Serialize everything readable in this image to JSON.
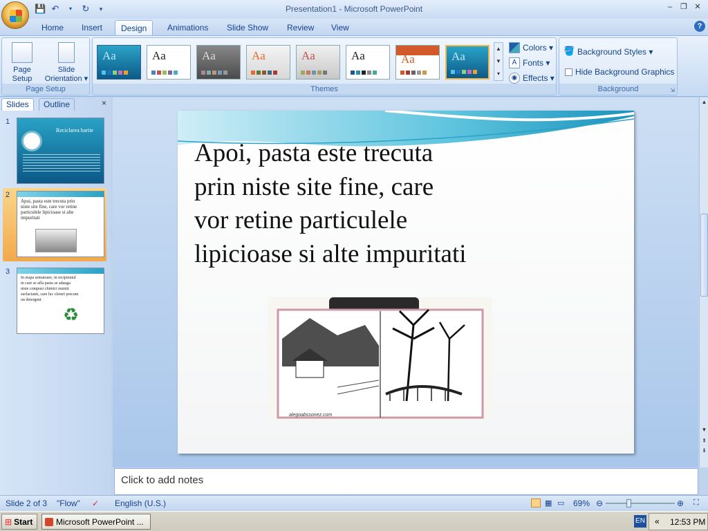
{
  "window": {
    "title": "Presentation1 - Microsoft PowerPoint"
  },
  "qat": {
    "save_icon": "save-icon",
    "undo_icon": "undo-icon",
    "redo_icon": "redo-icon",
    "customize_icon": "customize-icon"
  },
  "tabs": [
    {
      "label": "Home"
    },
    {
      "label": "Insert"
    },
    {
      "label": "Design"
    },
    {
      "label": "Animations"
    },
    {
      "label": "Slide Show"
    },
    {
      "label": "Review"
    },
    {
      "label": "View"
    }
  ],
  "ribbon": {
    "page_setup": {
      "group_label": "Page Setup",
      "page_setup_label": "Page Setup",
      "orientation_label": "Slide Orientation ▾"
    },
    "themes": {
      "group_label": "Themes",
      "sample_text": "Aa",
      "colors_label": "Colors ▾",
      "fonts_label": "Fonts ▾",
      "effects_label": "Effects ▾"
    },
    "background": {
      "group_label": "Background",
      "styles_label": "Background Styles ▾",
      "hide_graphics_label": "Hide Background Graphics",
      "hide_graphics_checked": false
    }
  },
  "panel": {
    "tabs": [
      {
        "label": "Slides"
      },
      {
        "label": "Outline"
      }
    ],
    "close_label": "×",
    "slides": [
      {
        "num": "1",
        "title": "Reciclarea hartie"
      },
      {
        "num": "2",
        "text": "Apoi, pasta este trecuta prin niste site fine, care vor retine particulele lipicioase si alte impuritati"
      },
      {
        "num": "3",
        "text": "In etapa urmatoare, in recipientul in care se afla pasta se adauga niste compusi chimici numiti surfactanti, care fac cleiuri precum un detergent"
      }
    ]
  },
  "slide": {
    "body_text": "Apoi, pasta este trecuta\nprin niste site fine, care\nvor retine particulele\nlipicioase si alte impuritati",
    "picture_caption": "alegoabssonez.com"
  },
  "notes": {
    "placeholder": "Click to add notes"
  },
  "status": {
    "slide_position": "Slide 2 of 3",
    "theme_name": "\"Flow\"",
    "language": "English (U.S.)",
    "zoom": "69%"
  },
  "taskbar": {
    "start_label": "Start",
    "task_label": "Microsoft PowerPoint ...",
    "language_indicator": "EN",
    "tray_expand": "«",
    "clock": "12:53 PM"
  }
}
